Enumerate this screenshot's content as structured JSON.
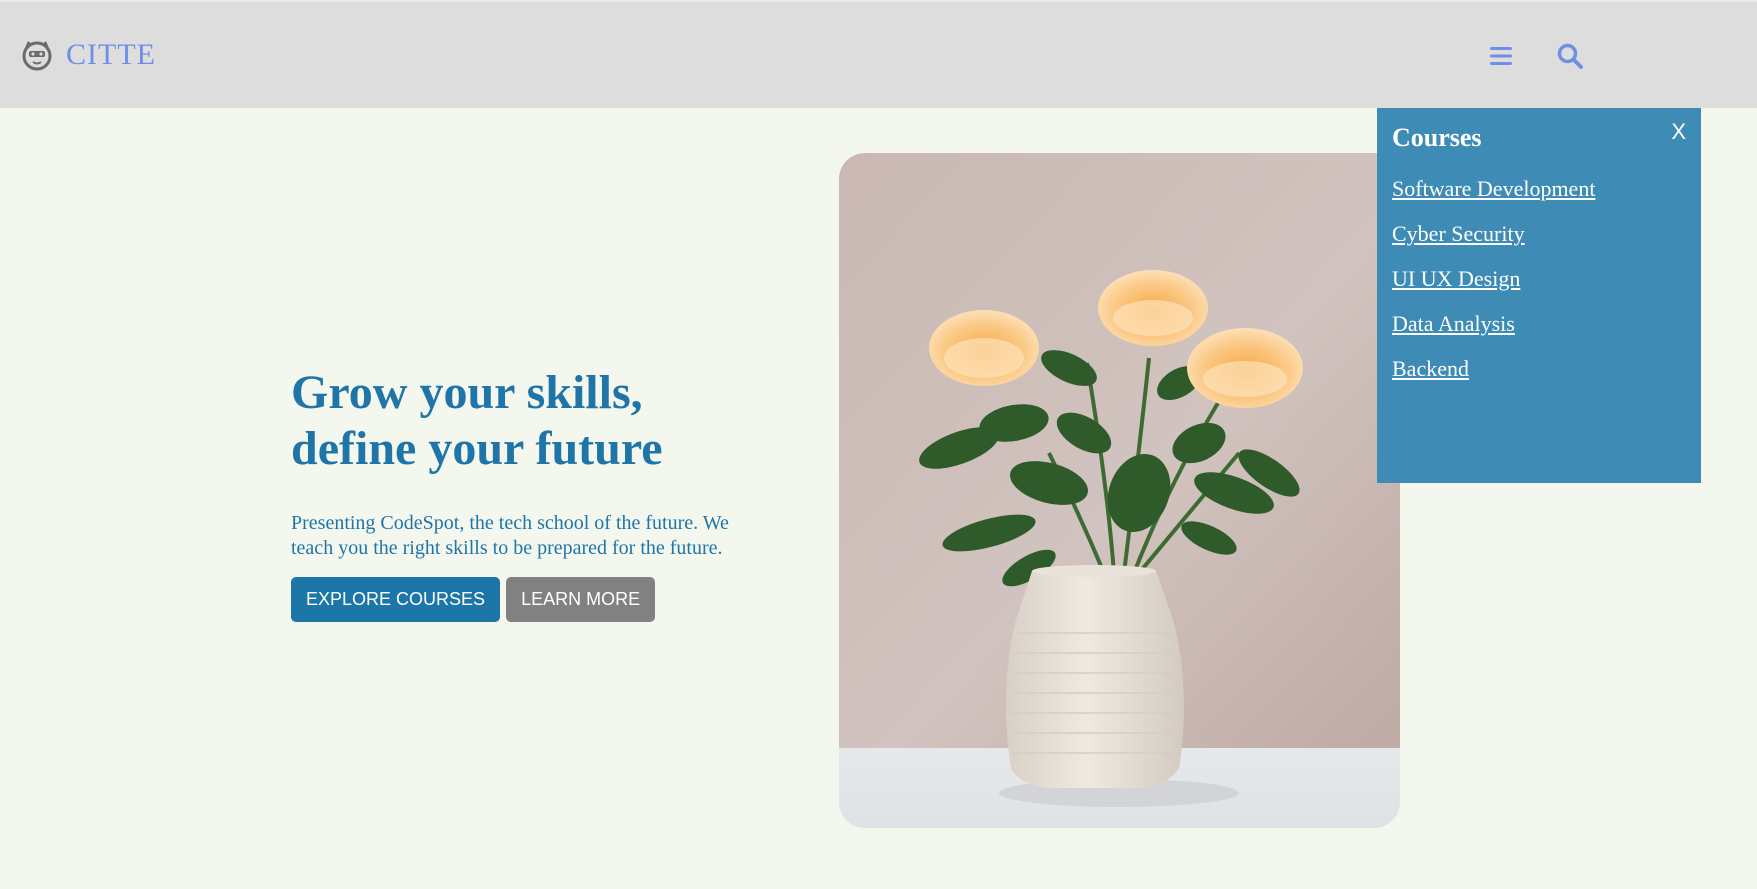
{
  "header": {
    "brand_name": "CITTE",
    "logo_icon": "cat-face-logo-icon",
    "menu_icon": "hamburger-menu-icon",
    "search_icon": "search-icon",
    "brand_color": "#6f8fe6",
    "background": "#dddddd"
  },
  "hero": {
    "title_line1": "Grow your skills,",
    "title_line2": "define your future",
    "description": "Presenting CodeSpot, the tech school of the future. We teach you the right skills to be prepared for the future.",
    "primary_button": "EXPLORE COURSES",
    "secondary_button": "LEARN MORE",
    "image_alt": "roses-in-vase-image",
    "text_color": "#1f75a8"
  },
  "courses_panel": {
    "title": "Courses",
    "close_label": "X",
    "items": [
      {
        "label": "Software Development"
      },
      {
        "label": "Cyber Security"
      },
      {
        "label": "UI UX Design"
      },
      {
        "label": "Data Analysis"
      },
      {
        "label": "Backend"
      }
    ],
    "background": "#3e8cb6"
  },
  "page": {
    "background": "#f3f7ed"
  }
}
